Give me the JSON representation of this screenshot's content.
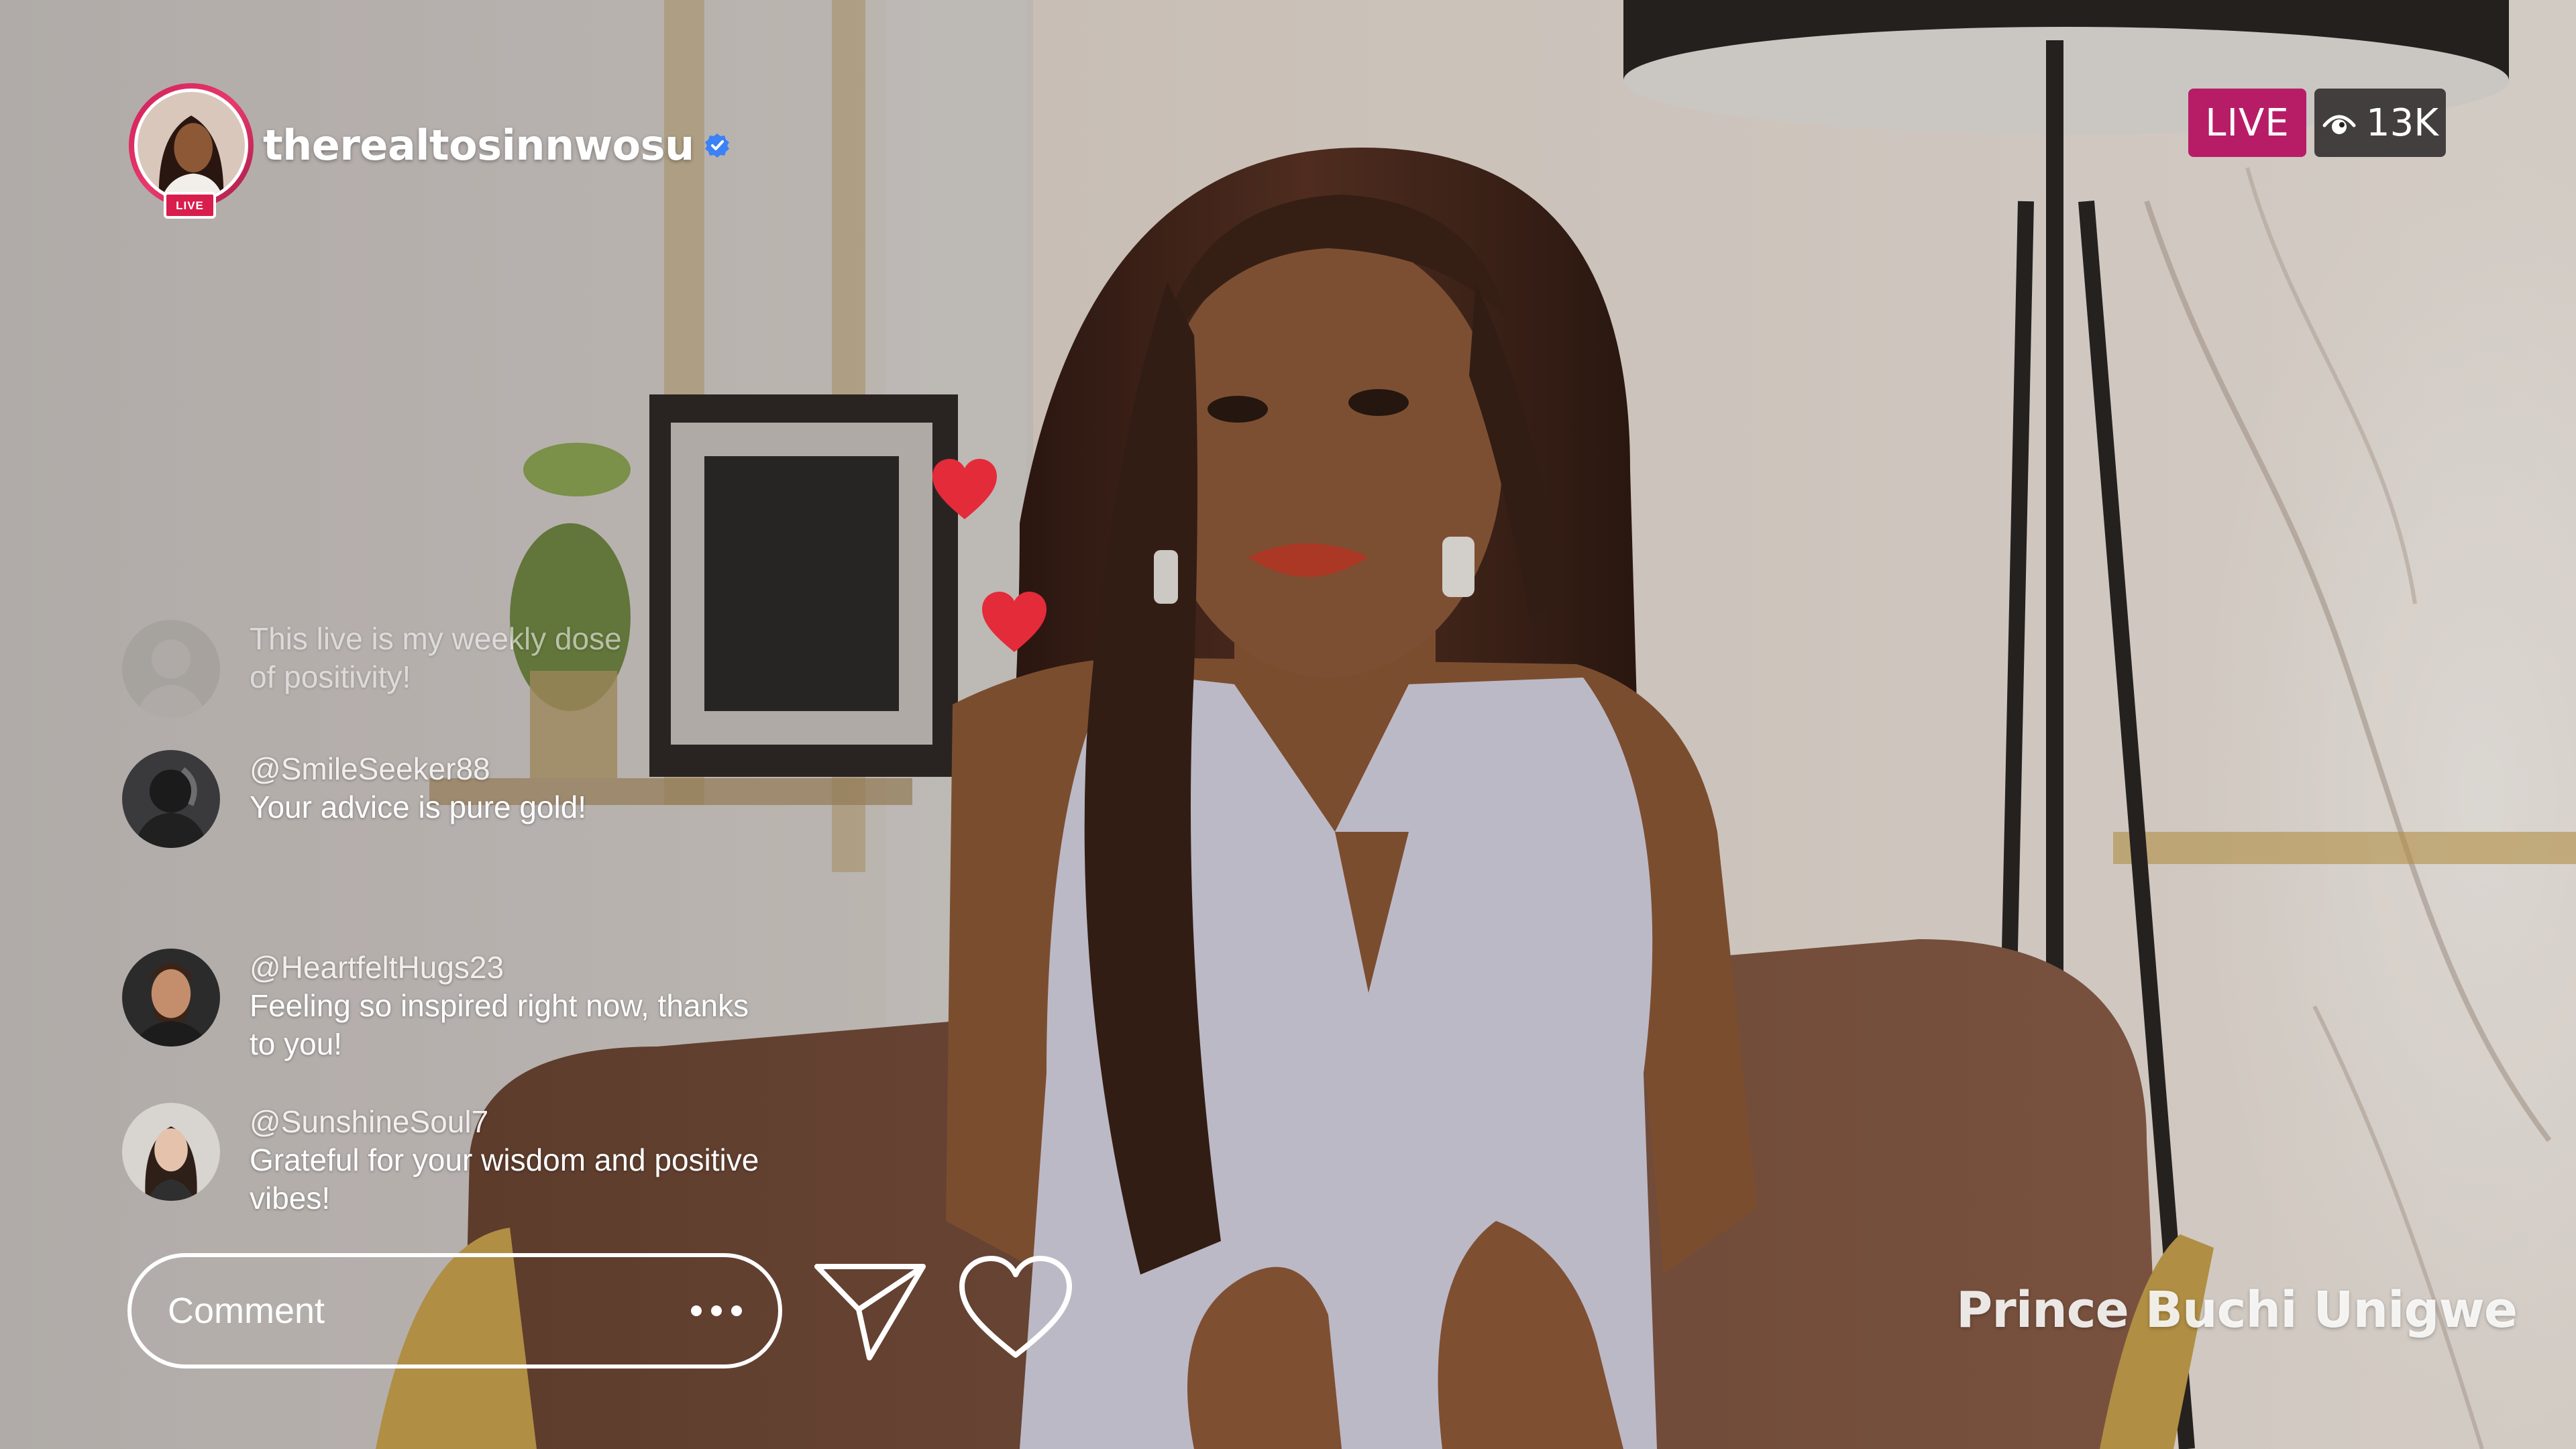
{
  "stream": {
    "username": "therealtosinnwosu",
    "profile_live_badge": "LIVE",
    "live_label": "LIVE",
    "viewer_count": "13K",
    "verified_color": "#3b82f6",
    "live_color": "#b71d66"
  },
  "comments": [
    {
      "handle": "",
      "lines": [
        "This live is my weekly dose",
        "of positivity!"
      ],
      "faded": true
    },
    {
      "handle": "@SmileSeeker88",
      "lines": [
        "Your advice is pure gold!"
      ]
    },
    {
      "handle": "@HeartfeltHugs23",
      "lines": [
        "Feeling so inspired right now, thanks",
        "to you!"
      ]
    },
    {
      "handle": "@SunshineSoul7",
      "lines": [
        "Grateful for your wisdom and positive",
        "vibes!"
      ]
    }
  ],
  "composer": {
    "placeholder": "Comment"
  },
  "icons": {
    "send": "send-icon",
    "like": "heart-outline-icon",
    "more": "more-dots-icon",
    "viewers": "eye-icon",
    "verified": "verified-check-icon",
    "floating": "heart-filled-icon"
  },
  "watermark": "Prince Buchi Unigwe"
}
